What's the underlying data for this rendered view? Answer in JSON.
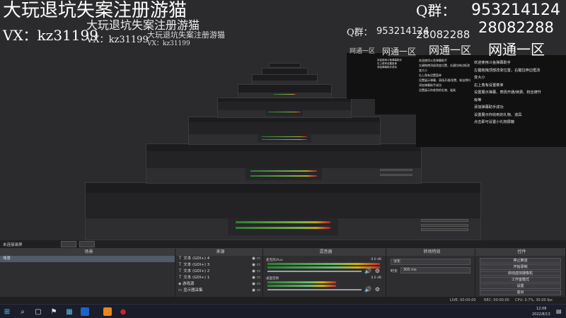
{
  "overlay": {
    "title": "大玩退坑失案注册游猫",
    "qq_label": "Q群：",
    "qq_number_1": "953214124",
    "qq_number_2": "28082288",
    "vx": "VX：kz31199",
    "vendor": "网通一区"
  },
  "side_panel": {
    "lines": [
      "欢迎使用斗鱼弹幕助手",
      "左键拖拽顶部改变位置，右键拉伸边框改",
      "变大小",
      "右上角有设置菜单",
      "设置展示弹幕、表扬开通/续费、粉丝牌升",
      "级等",
      "添加弹幕助手成功",
      "设置展示你收到的礼物、道具",
      "点击即可设置小礼物屏蔽"
    ]
  },
  "obs": {
    "window_title": "未连接录屏",
    "scenes_header": "场景",
    "scenes": [
      "场景"
    ],
    "sources_header": "来源",
    "sources": [
      {
        "icon": "text-icon",
        "name": "文本 (GDI+) 4"
      },
      {
        "icon": "text-icon",
        "name": "文本 (GDI+) 3"
      },
      {
        "icon": "text-icon",
        "name": "文本 (GDI+) 2"
      },
      {
        "icon": "text-icon",
        "name": "文本 (GDI+) 1"
      },
      {
        "icon": "game-icon",
        "name": "游戏源"
      },
      {
        "icon": "monitor-icon",
        "name": "显示器采集"
      }
    ],
    "mixer_header": "混音器",
    "mixer": [
      {
        "name": "麦克风/Aux",
        "db": "0.0 dB"
      },
      {
        "name": "桌面音频",
        "db": "0.0 dB"
      }
    ],
    "transition_header": "转场特效",
    "transition": {
      "type": "淡化",
      "duration_label": "时长",
      "duration": "300 ms"
    },
    "controls_header": "控件",
    "controls": [
      "停止推流",
      "开始录制",
      "启动虚拟摄像机",
      "工作室模式",
      "设置",
      "退出"
    ],
    "status": {
      "live": "LIVE: 00:00:00",
      "rec": "REC: 00:00:00",
      "cpu": "CPU: 0.7%, 30.00 fps"
    }
  },
  "taskbar": {
    "time": "12:08",
    "date": "2022/8/13"
  }
}
